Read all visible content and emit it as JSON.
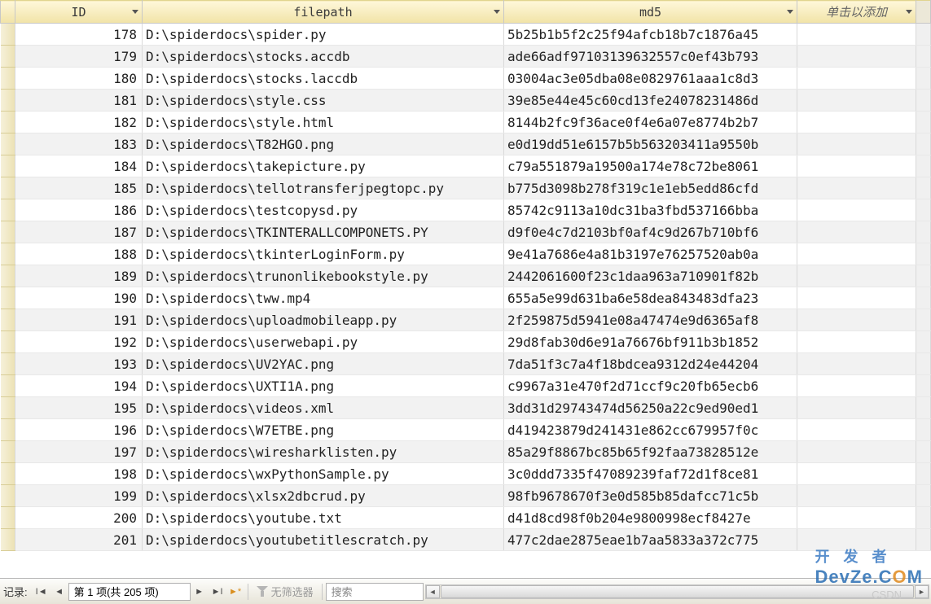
{
  "columns": {
    "id": "ID",
    "filepath": "filepath",
    "md5": "md5",
    "add": "单击以添加"
  },
  "rows": [
    {
      "id": "178",
      "fp": "D:\\spiderdocs\\spider.py",
      "md5": "5b25b1b5f2c25f94afcb18b7c1876a45"
    },
    {
      "id": "179",
      "fp": "D:\\spiderdocs\\stocks.accdb",
      "md5": "ade66adf97103139632557c0ef43b793"
    },
    {
      "id": "180",
      "fp": "D:\\spiderdocs\\stocks.laccdb",
      "md5": "03004ac3e05dba08e0829761aaa1c8d3"
    },
    {
      "id": "181",
      "fp": "D:\\spiderdocs\\style.css",
      "md5": "39e85e44e45c60cd13fe24078231486d"
    },
    {
      "id": "182",
      "fp": "D:\\spiderdocs\\style.html",
      "md5": "8144b2fc9f36ace0f4e6a07e8774b2b7"
    },
    {
      "id": "183",
      "fp": "D:\\spiderdocs\\T82HGO.png",
      "md5": "e0d19dd51e6157b5b563203411a9550b"
    },
    {
      "id": "184",
      "fp": "D:\\spiderdocs\\takepicture.py",
      "md5": "c79a551879a19500a174e78c72be8061"
    },
    {
      "id": "185",
      "fp": "D:\\spiderdocs\\tellotransferjpegtopc.py",
      "md5": "b775d3098b278f319c1e1eb5edd86cfd"
    },
    {
      "id": "186",
      "fp": "D:\\spiderdocs\\testcopysd.py",
      "md5": "85742c9113a10dc31ba3fbd537166bba"
    },
    {
      "id": "187",
      "fp": "D:\\spiderdocs\\TKINTERALLCOMPONETS.PY",
      "md5": "d9f0e4c7d2103bf0af4c9d267b710bf6"
    },
    {
      "id": "188",
      "fp": "D:\\spiderdocs\\tkinterLoginForm.py",
      "md5": "9e41a7686e4a81b3197e76257520ab0a"
    },
    {
      "id": "189",
      "fp": "D:\\spiderdocs\\trunonlikebookstyle.py",
      "md5": "2442061600f23c1daa963a710901f82b"
    },
    {
      "id": "190",
      "fp": "D:\\spiderdocs\\tww.mp4",
      "md5": "655a5e99d631ba6e58dea843483dfa23"
    },
    {
      "id": "191",
      "fp": "D:\\spiderdocs\\uploadmobileapp.py",
      "md5": "2f259875d5941e08a47474e9d6365af8"
    },
    {
      "id": "192",
      "fp": "D:\\spiderdocs\\userwebapi.py",
      "md5": "29d8fab30d6e91a76676bf911b3b1852"
    },
    {
      "id": "193",
      "fp": "D:\\spiderdocs\\UV2YAC.png",
      "md5": "7da51f3c7a4f18bdcea9312d24e44204"
    },
    {
      "id": "194",
      "fp": "D:\\spiderdocs\\UXTI1A.png",
      "md5": "c9967a31e470f2d71ccf9c20fb65ecb6"
    },
    {
      "id": "195",
      "fp": "D:\\spiderdocs\\videos.xml",
      "md5": "3dd31d29743474d56250a22c9ed90ed1"
    },
    {
      "id": "196",
      "fp": "D:\\spiderdocs\\W7ETBE.png",
      "md5": "d419423879d241431e862cc679957f0c"
    },
    {
      "id": "197",
      "fp": "D:\\spiderdocs\\wiresharklisten.py",
      "md5": "85a29f8867bc85b65f92faa73828512e"
    },
    {
      "id": "198",
      "fp": "D:\\spiderdocs\\wxPythonSample.py",
      "md5": "3c0ddd7335f47089239faf72d1f8ce81"
    },
    {
      "id": "199",
      "fp": "D:\\spiderdocs\\xlsx2dbcrud.py",
      "md5": "98fb9678670f3e0d585b85dafcc71c5b"
    },
    {
      "id": "200",
      "fp": "D:\\spiderdocs\\youtube.txt",
      "md5": "d41d8cd98f0b204e9800998ecf8427e"
    },
    {
      "id": "201",
      "fp": "D:\\spiderdocs\\youtubetitlescratch.py",
      "md5": "477c2dae2875eae1b7aa5833a372c775"
    }
  ],
  "status": {
    "record_label": "记录:",
    "record_text": "第 1 项(共 205 项)",
    "no_filter": "无筛选器",
    "search_placeholder": "搜索"
  },
  "watermark": {
    "top_pre": "开 发 者",
    "bottom": "DevZe.C",
    "bottom_o": "O",
    "bottom_m": "M",
    "csdn": "CSDN"
  }
}
